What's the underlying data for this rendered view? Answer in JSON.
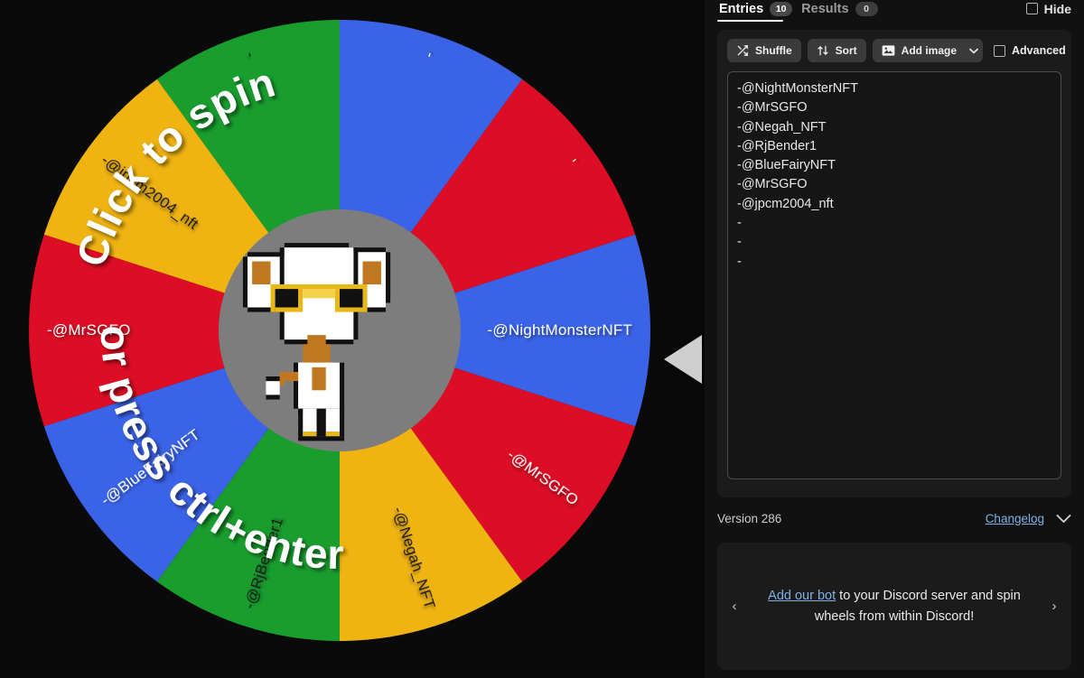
{
  "tabs": {
    "entries": {
      "label": "Entries",
      "count": "10"
    },
    "results": {
      "label": "Results",
      "count": "0"
    },
    "hide": {
      "label": "Hide"
    }
  },
  "toolbar": {
    "shuffle_label": "Shuffle",
    "sort_label": "Sort",
    "add_image_label": "Add image",
    "advanced_label": "Advanced"
  },
  "entries": {
    "text": "-@NightMonsterNFT\n-@MrSGFO\n-@Negah_NFT\n-@RjBender1\n-@BlueFairyNFT\n-@MrSGFO\n-@jpcm2004_nft\n-\n-\n-",
    "items": [
      "-@NightMonsterNFT",
      "-@MrSGFO",
      "-@Negah_NFT",
      "-@RjBender1",
      "-@BlueFairyNFT",
      "-@MrSGFO",
      "-@jpcm2004_nft",
      "-",
      "-",
      "-"
    ]
  },
  "footer": {
    "version": "Version 286",
    "changelog": "Changelog"
  },
  "promo": {
    "link_text": "Add our bot",
    "rest_text": " to your Discord server and spin wheels from within Discord!",
    "prev": "‹",
    "next": "›"
  },
  "wheel": {
    "overlay_top": "Click to spin",
    "overlay_bottom": "or press ctrl+enter",
    "hub_image": "pixel-elephant-sunglasses-avatar",
    "hub_color": "#7d7d7d",
    "pointer": "left-pointing-triangle",
    "segment_colors": [
      "#199e2e",
      "#efb312",
      "#dc0d24",
      "#3b63e8"
    ],
    "label_colors": {
      "light": "#ffffff",
      "dark": "#1a1a1a"
    },
    "segments": [
      {
        "label": "-@NightMonsterNFT",
        "color": "#3b63e8",
        "text_color": "#ffffff"
      },
      {
        "label": "-@MrSGFO",
        "color": "#dc0d24",
        "text_color": "#ffffff"
      },
      {
        "label": "-@Negah_NFT",
        "color": "#efb312",
        "text_color": "#1a1a1a"
      },
      {
        "label": "-@RjBender1",
        "color": "#199e2e",
        "text_color": "#1a1a1a"
      },
      {
        "label": "-@BlueFairyNFT",
        "color": "#3b63e8",
        "text_color": "#ffffff"
      },
      {
        "label": "-@MrSGFO",
        "color": "#dc0d24",
        "text_color": "#ffffff"
      },
      {
        "label": "-@jpcm2004_nft",
        "color": "#efb312",
        "text_color": "#1a1a1a"
      },
      {
        "label": "-",
        "color": "#199e2e",
        "text_color": "#1a1a1a"
      },
      {
        "label": "-",
        "color": "#3b63e8",
        "text_color": "#ffffff"
      },
      {
        "label": "-",
        "color": "#dc0d24",
        "text_color": "#ffffff"
      }
    ]
  }
}
